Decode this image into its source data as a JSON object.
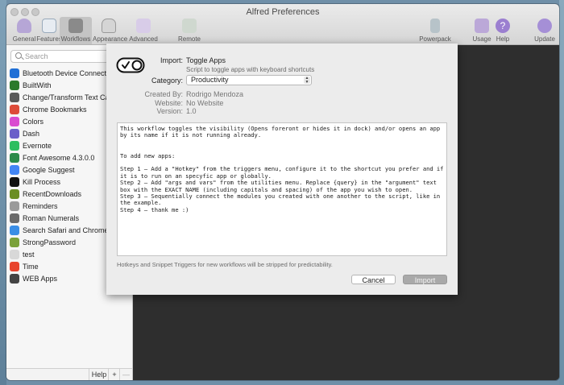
{
  "window": {
    "title": "Alfred Preferences"
  },
  "toolbar": {
    "items": [
      {
        "label": "General",
        "icon": "general-hat-icon"
      },
      {
        "label": "Features",
        "icon": "features-icon"
      },
      {
        "label": "Workflows",
        "icon": "workflows-icon"
      },
      {
        "label": "Appearance",
        "icon": "appearance-icon"
      },
      {
        "label": "Advanced",
        "icon": "advanced-icon"
      },
      {
        "label": "Remote",
        "icon": "remote-icon"
      },
      {
        "label": "Powerpack",
        "icon": "powerpack-icon"
      },
      {
        "label": "Usage",
        "icon": "usage-icon"
      },
      {
        "label": "Help",
        "icon": "help-icon"
      },
      {
        "label": "Update",
        "icon": "update-icon"
      }
    ],
    "selected": "Workflows"
  },
  "sidebar": {
    "search_placeholder": "Search",
    "workflows": [
      {
        "name": "Bluetooth Device Connector",
        "icon": "bluetooth-icon",
        "color": "#1f6fd6"
      },
      {
        "name": "BuiltWith",
        "icon": "builtwith-icon",
        "color": "#2b7a2b"
      },
      {
        "name": "Change/Transform Text Case",
        "icon": "text-case-icon",
        "color": "#5a5a5a"
      },
      {
        "name": "Chrome Bookmarks",
        "icon": "chrome-icon",
        "color": "#dd4b39"
      },
      {
        "name": "Colors",
        "icon": "colors-icon",
        "color": "#d94bd0"
      },
      {
        "name": "Dash",
        "icon": "dash-icon",
        "color": "#6b5fc9"
      },
      {
        "name": "Evernote",
        "icon": "evernote-icon",
        "color": "#2dbe60"
      },
      {
        "name": "Font Awesome 4.3.0.0",
        "icon": "font-awesome-icon",
        "color": "#2b8a4a"
      },
      {
        "name": "Google Suggest",
        "icon": "google-icon",
        "color": "#4285f4"
      },
      {
        "name": "Kill Process",
        "icon": "kill-process-icon",
        "color": "#111111"
      },
      {
        "name": "RecentDownloads",
        "icon": "downloads-icon",
        "color": "#6b8e23"
      },
      {
        "name": "Reminders",
        "icon": "reminders-icon",
        "color": "#9a9a9a"
      },
      {
        "name": "Roman Numerals",
        "icon": "roman-numerals-icon",
        "color": "#6a6a6a"
      },
      {
        "name": "Search Safari and Chrome Tabs",
        "icon": "safari-icon",
        "color": "#3a8ee6"
      },
      {
        "name": "StrongPassword",
        "icon": "lock-icon",
        "color": "#7aa13a"
      },
      {
        "name": "test",
        "icon": "blank-icon",
        "color": "#d8d8d8"
      },
      {
        "name": "Time",
        "icon": "clock-icon",
        "color": "#e8452e"
      },
      {
        "name": "WEB Apps",
        "icon": "web-apps-icon",
        "color": "#444444"
      }
    ],
    "footer": {
      "help": "Help",
      "add": "+",
      "remove": "—"
    }
  },
  "import_sheet": {
    "logo_icon": "toggle-switch-icon",
    "import_label": "Import:",
    "workflow_name": "Toggle Apps",
    "workflow_subtitle": "Script to toggle apps with keyboard shortcuts",
    "category_label": "Category:",
    "category_value": "Productivity",
    "created_by_label": "Created By:",
    "created_by_value": "Rodrigo Mendoza",
    "website_label": "Website:",
    "website_value": "No Website",
    "version_label": "Version:",
    "version_value": "1.0",
    "description": "This workflow toggles the visibility (Opens foreront or hides it in dock) and/or opens an app by its name if it is not running already.\n\n\nTo add new apps:\n\nStep 1 – Add a \"Hotkey\" from the triggers menu, configure it to the shortcut you prefer and if it is to run on an specyfic app or globally.\nStep 2 – Add \"args and vars\" from the utilities menu. Replace {query} in the \"argument\" text box with the EXACT NAME (including capitals and spacing) of the app you wish to open.\nStep 3 – Sequentially connect the modules you created with one another to the script, like in the example.\nStep 4 – thank me :)",
    "note": "Hotkeys and Snippet Triggers for new workflows will be stripped for predictability.",
    "cancel_label": "Cancel",
    "import_button_label": "Import"
  }
}
